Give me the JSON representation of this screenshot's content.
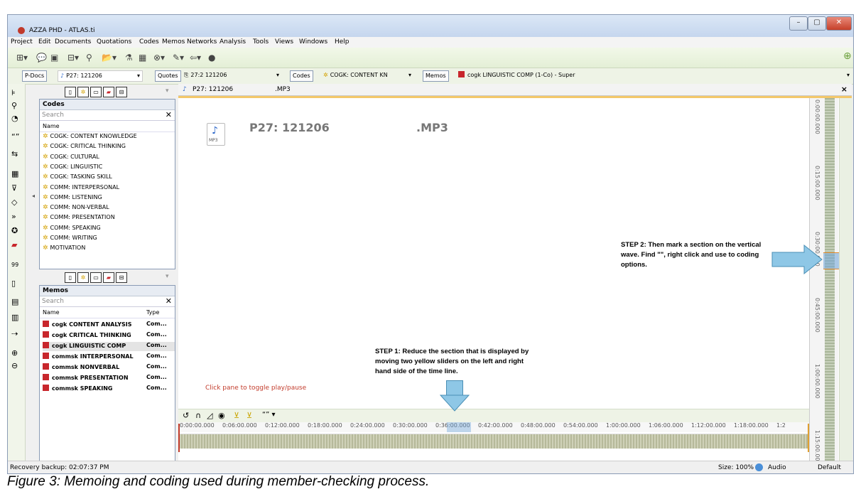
{
  "window": {
    "title": "AZZA PHD - ATLAS.ti"
  },
  "menu": [
    "Project",
    "Edit",
    "Documents",
    "Quotations",
    "Codes",
    "Memos",
    "Networks",
    "Analysis",
    "Tools",
    "Views",
    "Windows",
    "Help"
  ],
  "selectors": {
    "pdocs_label": "P-Docs",
    "pdocs_value": "P27: 121206",
    "quotes_label": "Quotes",
    "quotes_value": "27:2 121206",
    "codes_label": "Codes",
    "codes_value": "COGK: CONTENT KN",
    "memos_label": "Memos",
    "memos_value": "cogk LINGUISTIC COMP (1-Co) - Super"
  },
  "codes_panel": {
    "title": "Codes",
    "search_placeholder": "Search",
    "column": "Name",
    "items": [
      "COGK: CONTENT KNOWLEDGE",
      "COGK: CRITICAL THINKING",
      "COGK: CULTURAL",
      "COGK: LINGUISTIC",
      "COGK: TASKING SKILL",
      "COMM: INTERPERSONAL",
      "COMM: LISTENING",
      "COMM: NON-VERBAL",
      "COMM: PRESENTATION",
      "COMM: SPEAKING",
      "COMM: WRITING",
      "MOTIVATION"
    ]
  },
  "memos_panel": {
    "title": "Memos",
    "search_placeholder": "Search",
    "col_name": "Name",
    "col_type": "Type",
    "items": [
      {
        "name": "cogk CONTENT ANALYSIS",
        "type": "Com..."
      },
      {
        "name": "cogk CRITICAL THINKING",
        "type": "Com..."
      },
      {
        "name": "cogk LINGUISTIC COMP",
        "type": "Com..."
      },
      {
        "name": "commsk INTERPERSONAL",
        "type": "Com..."
      },
      {
        "name": "commsk NONVERBAL",
        "type": "Com..."
      },
      {
        "name": "commsk PRESENTATION",
        "type": "Com..."
      },
      {
        "name": "commsk SPEAKING",
        "type": "Com..."
      }
    ]
  },
  "document": {
    "tab_title": "P27: 121206",
    "tab_ext": ".MP3",
    "heading": "P27: 121206",
    "heading_ext": ".MP3",
    "file_icon_label": "MP3",
    "toggle_hint": "Click pane to toggle play/pause",
    "close": "×"
  },
  "timeline": {
    "ticks": [
      "0:00:00.000",
      "0:06:00.000",
      "0:12:00.000",
      "0:18:00.000",
      "0:24:00.000",
      "0:30:00.000",
      "0:36:00.000",
      "0:42:00.000",
      "0:48:00.000",
      "0:54:00.000",
      "1:00:00.000",
      "1:06:00.000",
      "1:12:00.000",
      "1:18:00.000",
      "1:2"
    ]
  },
  "vertical_times": [
    "0:00:00.000",
    "0:15:00.000",
    "0:30:00.000",
    "0:45:00.000",
    "1:00:00.000",
    "1:15:00.000"
  ],
  "annotations": {
    "step1": "STEP 1: Reduce the section that is displayed by moving two yellow sliders on the left and right hand side of the time line.",
    "step2": "STEP 2: Then mark a section on the vertical wave. Find \"\", right click and use to coding options."
  },
  "status": {
    "left": "Recovery backup: 02:07:37 PM",
    "size": "Size: 100%",
    "audio": "Audio",
    "default": "Default"
  },
  "caption": "Figure 3: Memoing and coding used during member-checking process."
}
